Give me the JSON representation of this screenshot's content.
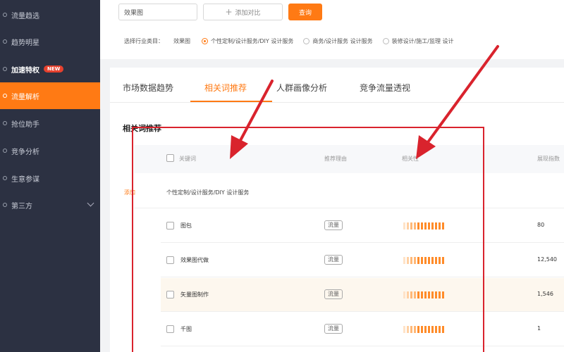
{
  "sidebar": {
    "items": [
      {
        "label": "流量趋选",
        "active": false
      },
      {
        "label": "趋势明星",
        "active": false
      },
      {
        "label": "加速特权",
        "badge": "NEW",
        "active": false
      },
      {
        "label": "流量解析",
        "active": true
      },
      {
        "label": "抢位助手",
        "active": false
      },
      {
        "label": "竞争分析",
        "active": false
      },
      {
        "label": "生意参谋",
        "active": false
      },
      {
        "label": "第三方",
        "active": false
      }
    ]
  },
  "search": {
    "value": "效果图",
    "compare_label": "添加对比",
    "query_label": "查询"
  },
  "category": {
    "label": "选择行业类目：",
    "keyword": "效果图",
    "options": [
      {
        "label": "个性定制/设计服务/DIY 设计服务",
        "selected": true
      },
      {
        "label": "商务/设计服务 设计服务",
        "selected": false
      },
      {
        "label": "装修设计/施工/监理 设计",
        "selected": false
      }
    ]
  },
  "tabs": [
    {
      "label": "市场数据趋势",
      "active": false
    },
    {
      "label": "相关词推荐",
      "active": true
    },
    {
      "label": "人群画像分析",
      "active": false
    },
    {
      "label": "竞争流量透视",
      "active": false
    }
  ],
  "section_title": "相关词推荐",
  "table": {
    "columns": [
      "关键词",
      "推荐理由",
      "相关性",
      "展现指数"
    ],
    "group": {
      "tag": "添加",
      "name": "个性定制/设计服务/DIY 设计服务"
    },
    "rows": [
      {
        "keyword": "图包",
        "reason": "流量",
        "relevance": 0.7,
        "value": "80"
      },
      {
        "keyword": "效果图代做",
        "reason": "流量",
        "relevance": 0.7,
        "value": "12,540"
      },
      {
        "keyword": "矢量图制作",
        "reason": "流量",
        "relevance": 0.7,
        "value": "1,546"
      },
      {
        "keyword": "千图",
        "reason": "流量",
        "relevance": 0.7,
        "value": "1"
      }
    ]
  },
  "colors": {
    "accent": "#ff7a14",
    "sidebar_bg": "#2c3142",
    "annotation_red": "#d9232d"
  }
}
